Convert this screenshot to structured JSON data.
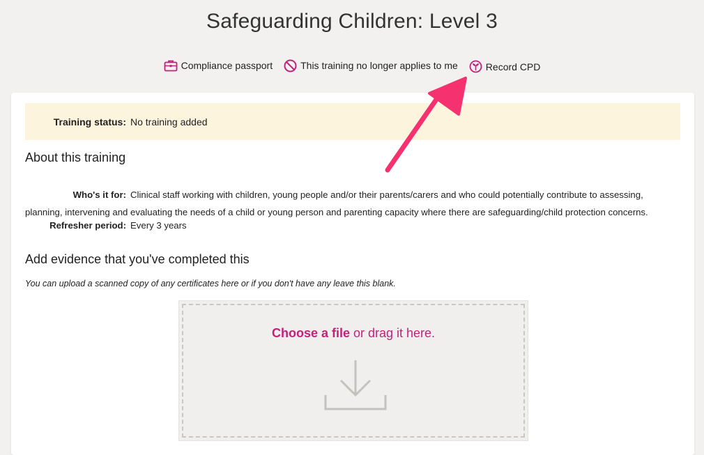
{
  "page": {
    "title": "Safeguarding Children: Level 3"
  },
  "actions": {
    "compliance_label": "Compliance passport",
    "not_applicable_label": "This training no longer applies to me",
    "record_cpd_label": "Record CPD"
  },
  "status": {
    "label": "Training status:",
    "value": "No training added"
  },
  "about": {
    "heading": "About this training",
    "who_label": "Who's it for:",
    "who_value": "Clinical staff working with children, young people and/or their parents/carers and who could potentially contribute to assessing, planning, intervening and evaluating the needs of a child or young person and parenting capacity where there are safeguarding/child protection concerns.",
    "refresher_label": "Refresher period:",
    "refresher_value": "Every 3 years"
  },
  "evidence": {
    "heading": "Add evidence that you've completed this",
    "hint": "You can upload a scanned copy of any certificates here or if you don't have any leave this blank.",
    "choose_label": "Choose a file",
    "drag_label": " or drag it here."
  },
  "colors": {
    "accent": "#c2217b",
    "annotation_arrow": "#f5316f",
    "status_background": "#fcf4dc",
    "page_background": "#f2f1ef"
  },
  "icons": [
    "briefcase-icon",
    "prohibited-icon",
    "sprout-icon",
    "download-icon"
  ]
}
